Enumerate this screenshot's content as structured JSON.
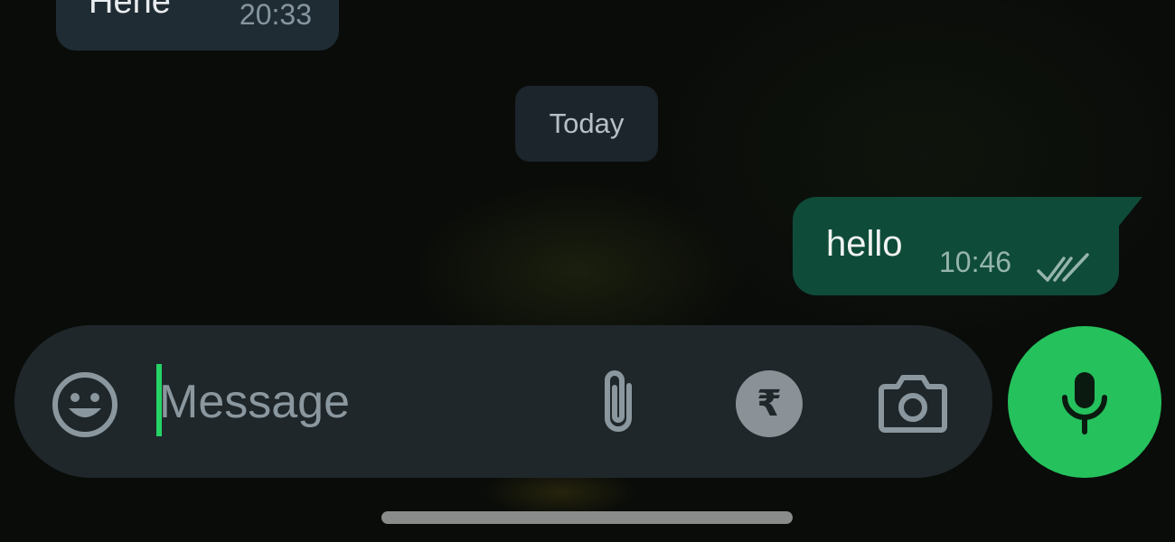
{
  "messages": {
    "incoming": {
      "text": "Hehe",
      "time": "20:33"
    },
    "date_separator": "Today",
    "outgoing": {
      "text": "hello",
      "time": "10:46",
      "status_icon": "double-check-icon"
    }
  },
  "composer": {
    "placeholder": "Message",
    "value": "",
    "emoji_icon": "emoji-icon",
    "attach_icon": "paperclip-icon",
    "payment_symbol": "₹",
    "payment_icon": "rupee-icon",
    "camera_icon": "camera-icon",
    "mic_icon": "mic-icon"
  },
  "colors": {
    "accent": "#25c15d",
    "outgoing_bubble": "#0f4b39",
    "incoming_bubble": "#1f2c33",
    "input_bar": "#1f272b"
  }
}
